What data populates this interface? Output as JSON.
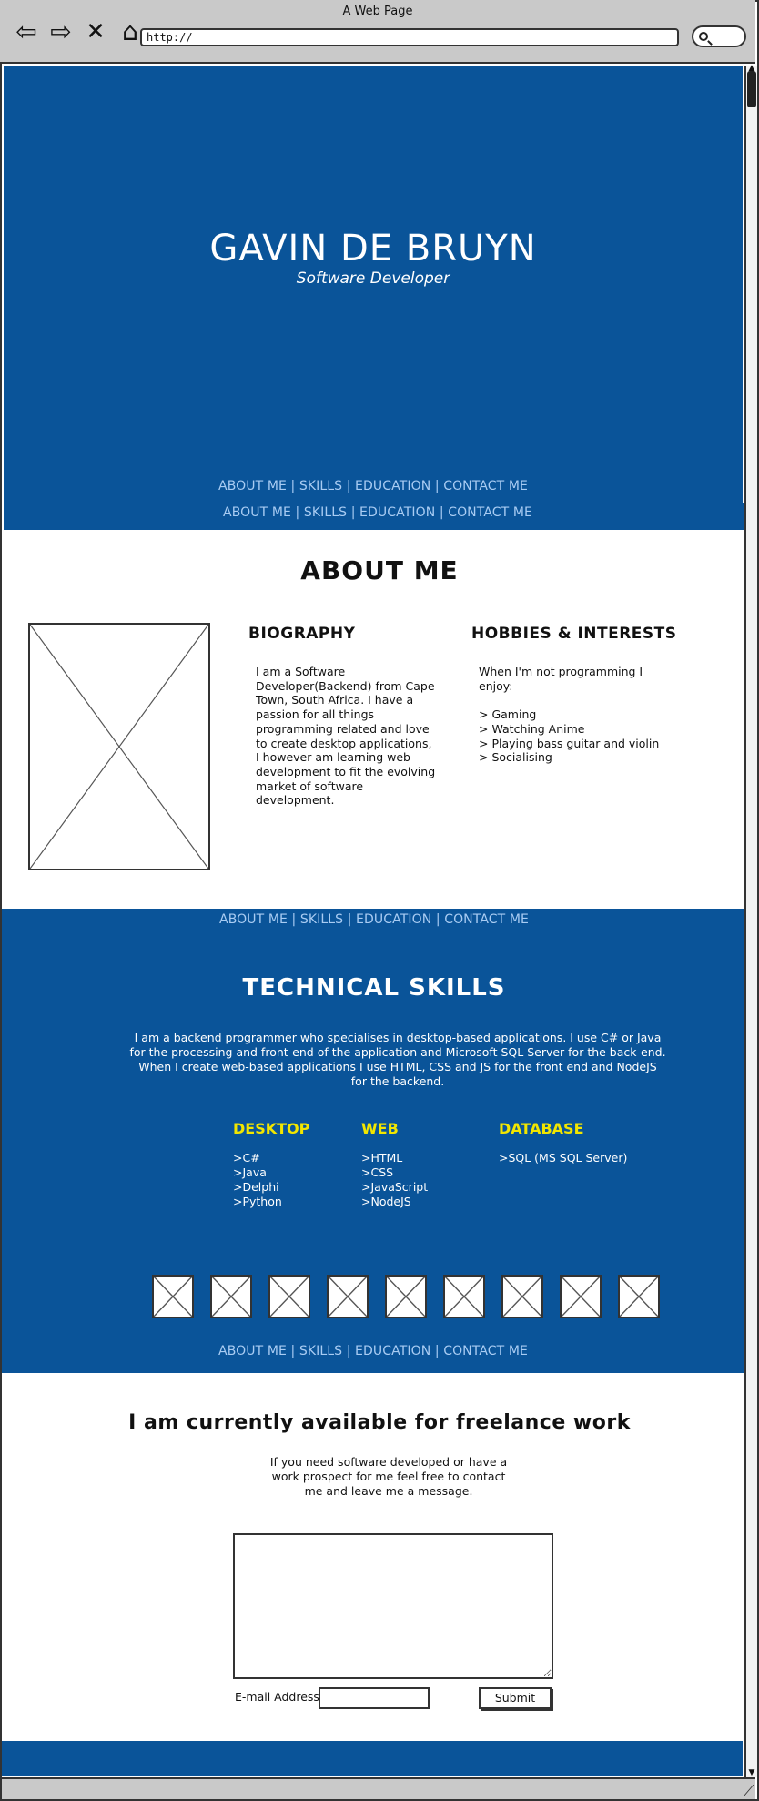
{
  "browser": {
    "title": "A Web Page",
    "url": "http://",
    "icons": [
      "back-icon",
      "forward-icon",
      "stop-icon",
      "home-icon",
      "search-icon"
    ]
  },
  "hero": {
    "name": "GAVIN DE BRUYN",
    "role": "Software Developer"
  },
  "nav": {
    "links": "ABOUT ME | SKILLS | EDUCATION | CONTACT ME"
  },
  "about": {
    "title": "ABOUT ME",
    "biography_heading": "BIOGRAPHY",
    "biography_text": "I am a Software\nDeveloper(Backend) from Cape\nTown, South Africa. I have a\npassion for all things\nprogramming related and love\nto create desktop applications,\nI however am learning web\ndevelopment to fit the evolving\nmarket of software\ndevelopment.",
    "hobbies_heading": "HOBBIES & INTERESTS",
    "hobbies_text": "When I'm not programming I\nenjoy:\n\n> Gaming\n> Watching Anime\n> Playing bass guitar and violin\n> Socialising"
  },
  "skills": {
    "title": "TECHNICAL SKILLS",
    "intro": "I am a backend programmer who specialises in desktop-based applications. I use C# or Java for the processing and front-end of the application and Microsoft SQL Server for the back-end. When I create web-based applications I use HTML, CSS  and JS for the front end and NodeJS for the backend.",
    "desktop_heading": "DESKTOP",
    "desktop_list": ">C#\n>Java\n>Delphi\n>Python",
    "web_heading": "WEB",
    "web_list": ">HTML\n>CSS\n>JavaScript\n>NodeJS",
    "database_heading": "DATABASE",
    "database_list": ">SQL (MS SQL Server)",
    "logo_count": 9
  },
  "contact": {
    "title": "I am currently available for freelance work",
    "text": "If you need software developed or have a work prospect for me feel free to contact me and leave me a message.",
    "email_label": "E-mail Address:",
    "submit_label": "Submit"
  },
  "colors": {
    "brand_blue": "#0a5499",
    "nav_link": "#a9ccf3",
    "skill_heading": "#f2e600"
  }
}
